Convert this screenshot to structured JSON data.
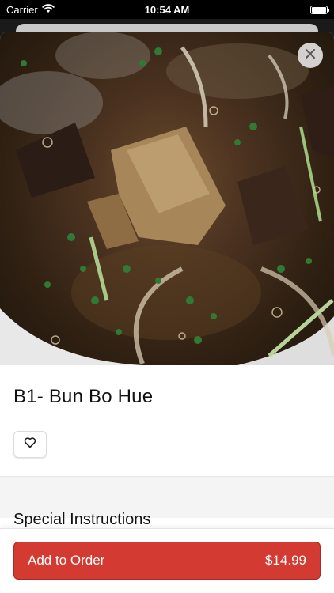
{
  "status_bar": {
    "carrier": "Carrier",
    "time": "10:54 AM"
  },
  "item": {
    "title": "B1- Bun Bo Hue"
  },
  "sections": {
    "special_instructions": "Special Instructions"
  },
  "footer": {
    "add_label": "Add to Order",
    "price": "$14.99"
  },
  "colors": {
    "accent": "#d23a32",
    "accent_border": "#a82b25"
  },
  "icons": {
    "close": "close-icon",
    "favorite": "heart-icon",
    "wifi": "wifi-icon",
    "battery": "battery-icon"
  }
}
